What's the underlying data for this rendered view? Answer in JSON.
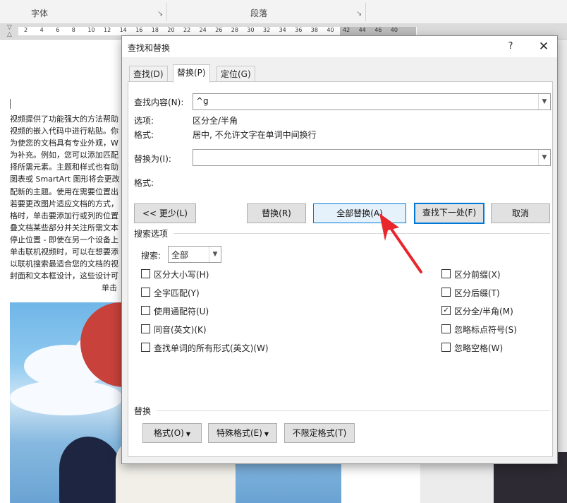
{
  "ribbon": {
    "group_font": "字体",
    "group_paragraph": "段落"
  },
  "ruler": {
    "ticks": [
      "2",
      "4",
      "6",
      "8",
      "10",
      "12",
      "14",
      "16",
      "18",
      "20",
      "22",
      "24",
      "26",
      "28",
      "30",
      "32",
      "34",
      "36",
      "38",
      "40",
      "42",
      "44",
      "46",
      "40"
    ]
  },
  "document": {
    "lines": [
      "视频提供了功能强大的方法帮助",
      "视频的嵌入代码中进行粘贴。你",
      "为使您的文档具有专业外观，W",
      "为补充。例如，您可以添加匹配",
      "择所需元素。主题和样式也有助",
      "图表或 SmartArt 图形将会更改",
      "配新的主题。使用在需要位置出",
      "若要更改图片适应文档的方式，",
      "格时，单击要添加行或列的位置",
      "叠文档某些部分并关注所需文本",
      "停止位置 - 即使在另一个设备上",
      "单击联机视频时，可以在想要添",
      "以联机搜索最适合您的文档的视",
      "封面和文本框设计，这些设计可",
      "单击"
    ]
  },
  "dialog": {
    "title": "查找和替换",
    "help": "?",
    "close": "✕",
    "tabs": [
      "查找(D)",
      "替换(P)",
      "定位(G)"
    ],
    "find_label": "查找内容(N):",
    "find_value": "^g",
    "options_label": "选项:",
    "options_value": "区分全/半角",
    "format_label": "格式:",
    "format_value": "居中, 不允许文字在单词中间换行",
    "replace_label": "替换为(I):",
    "replace_value": "",
    "replace_format_label": "格式:",
    "buttons": {
      "less": "<< 更少(L)",
      "replace": "替换(R)",
      "replace_all": "全部替换(A)",
      "find_next": "查找下一处(F)",
      "cancel": "取消"
    },
    "search_options_title": "搜索选项",
    "search_label": "搜索:",
    "search_value": "全部",
    "left_options": [
      {
        "label": "区分大小写(H)",
        "checked": false
      },
      {
        "label": "全字匹配(Y)",
        "checked": false
      },
      {
        "label": "使用通配符(U)",
        "checked": false
      },
      {
        "label": "同音(英文)(K)",
        "checked": false
      },
      {
        "label": "查找单词的所有形式(英文)(W)",
        "checked": false
      }
    ],
    "right_options": [
      {
        "label": "区分前缀(X)",
        "checked": false
      },
      {
        "label": "区分后缀(T)",
        "checked": false
      },
      {
        "label": "区分全/半角(M)",
        "checked": true
      },
      {
        "label": "忽略标点符号(S)",
        "checked": false
      },
      {
        "label": "忽略空格(W)",
        "checked": false
      }
    ],
    "replace_section_title": "替换",
    "bottom_buttons": {
      "format": "格式(O)",
      "special": "特殊格式(E)",
      "no_format": "不限定格式(T)"
    }
  },
  "colors": {
    "accent": "#0078d7",
    "annotation_arrow": "#e8262b"
  }
}
